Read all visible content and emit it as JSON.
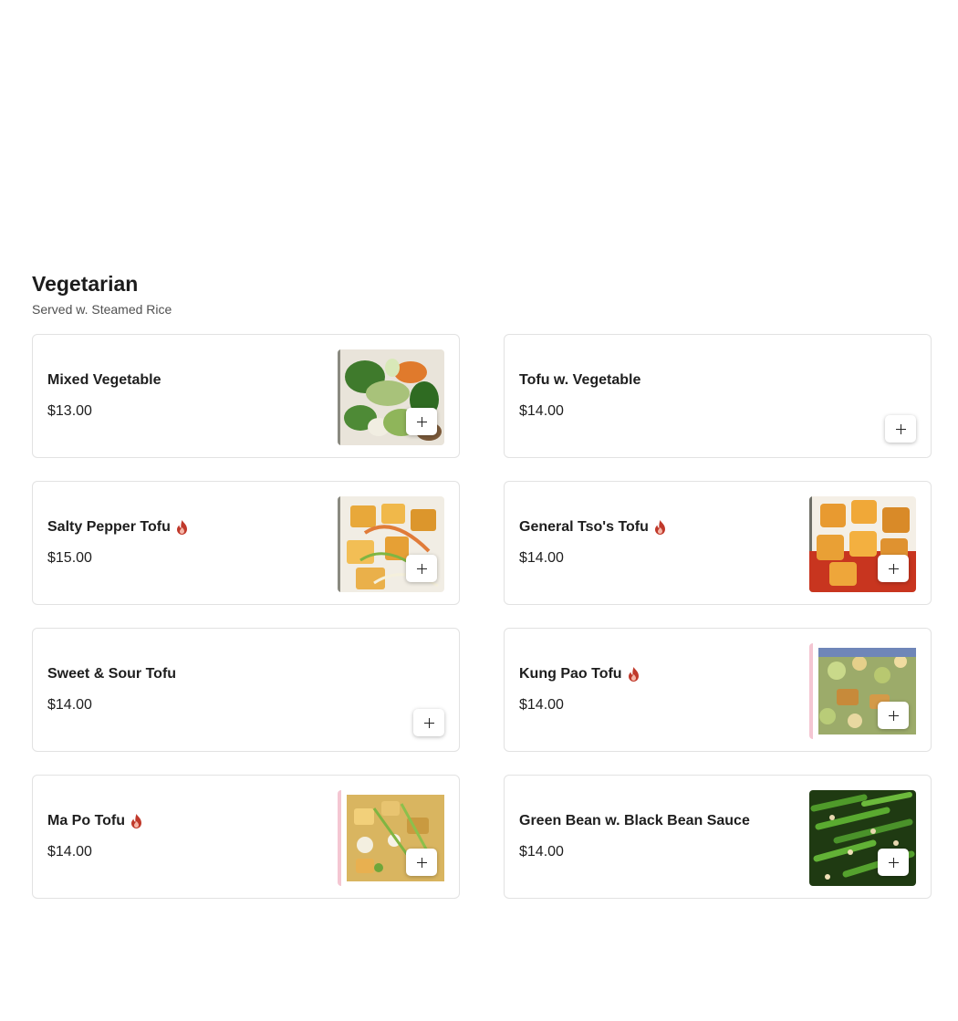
{
  "section": {
    "title": "Vegetarian",
    "subtitle": "Served w. Steamed Rice"
  },
  "colors": {
    "spicy": "#c0392b",
    "card_border": "#e2e2e2",
    "text": "#1e1e1e"
  },
  "items": [
    {
      "name": "Mixed Vegetable",
      "price": "$13.00",
      "spicy": false,
      "has_image": true,
      "image": "mixed-vegetable-photo"
    },
    {
      "name": "Tofu w. Vegetable",
      "price": "$14.00",
      "spicy": false,
      "has_image": false
    },
    {
      "name": "Salty Pepper Tofu",
      "price": "$15.00",
      "spicy": true,
      "has_image": true,
      "image": "salty-pepper-tofu-photo"
    },
    {
      "name": "General Tso's Tofu",
      "price": "$14.00",
      "spicy": true,
      "has_image": true,
      "image": "general-tsos-tofu-photo"
    },
    {
      "name": "Sweet & Sour Tofu",
      "price": "$14.00",
      "spicy": false,
      "has_image": false
    },
    {
      "name": "Kung Pao Tofu",
      "price": "$14.00",
      "spicy": true,
      "has_image": true,
      "image": "kung-pao-tofu-photo"
    },
    {
      "name": "Ma Po Tofu",
      "price": "$14.00",
      "spicy": true,
      "has_image": true,
      "image": "ma-po-tofu-photo"
    },
    {
      "name": "Green Bean w. Black Bean Sauce",
      "price": "$14.00",
      "spicy": false,
      "has_image": true,
      "image": "green-bean-photo"
    }
  ],
  "icons": {
    "spicy": "flame-icon",
    "add": "plus-icon"
  }
}
